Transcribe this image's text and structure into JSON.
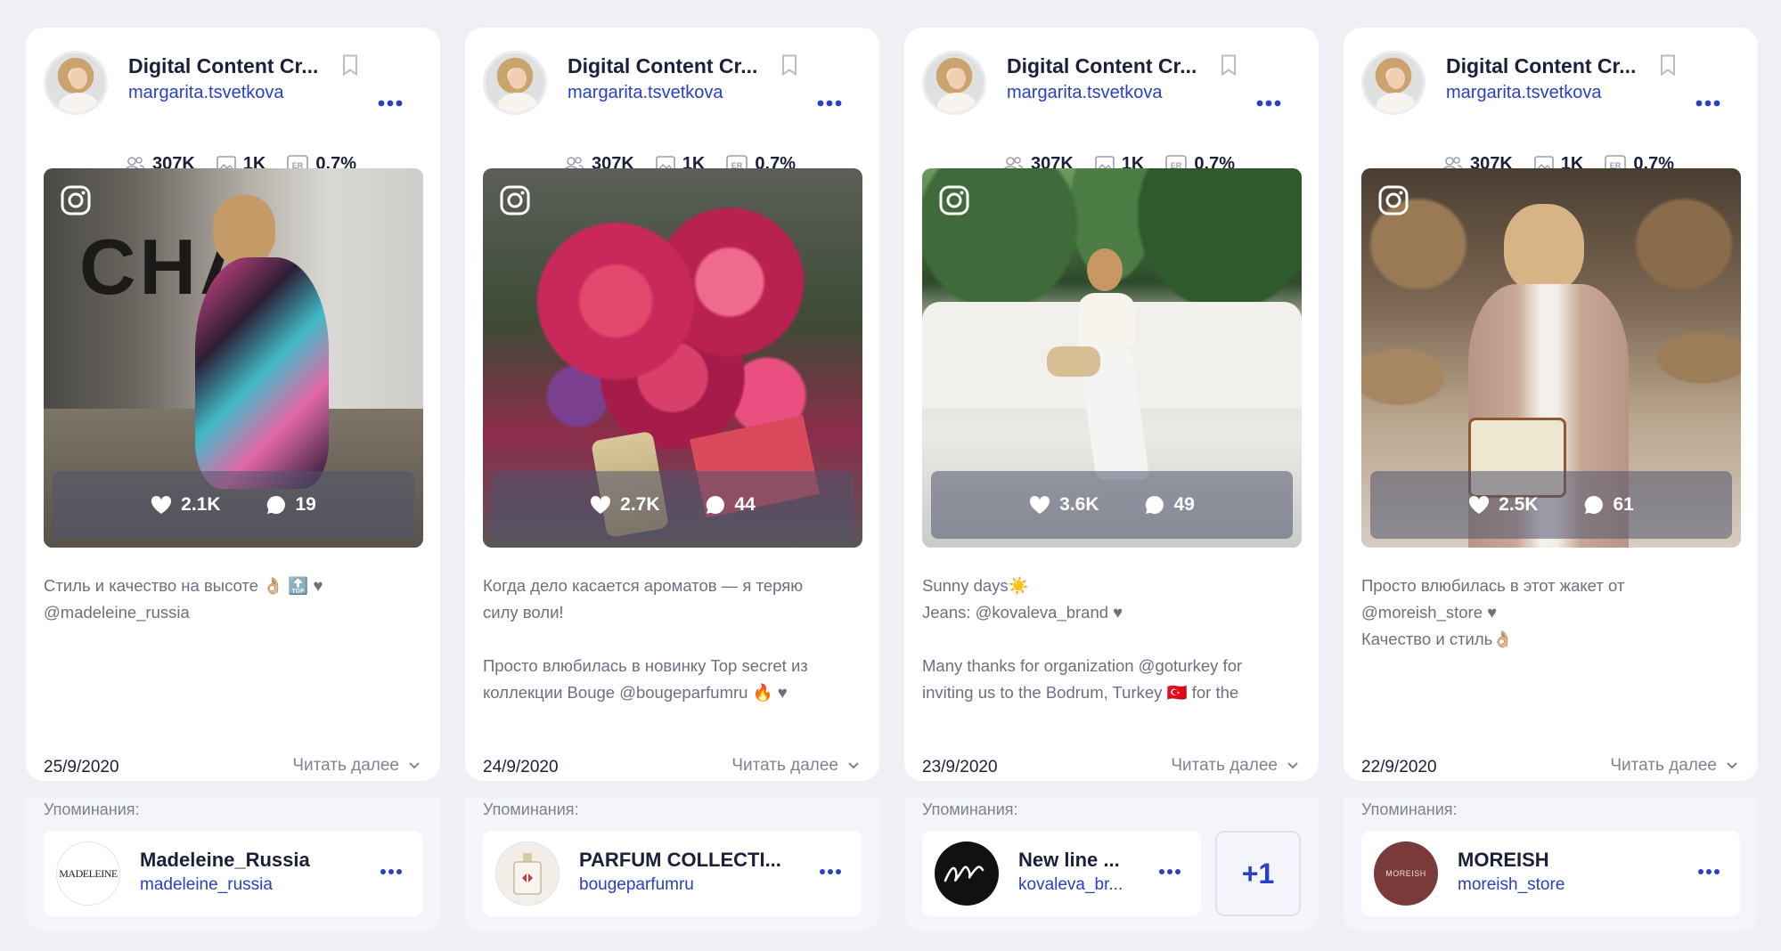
{
  "colors": {
    "accent": "#2a40c0",
    "background": "#eef0f6",
    "card": "#ffffff"
  },
  "icons": {
    "bookmark": "bookmark-icon",
    "more": "more-dots-icon",
    "followers": "followers-icon",
    "posts": "image-icon",
    "er": "er-icon",
    "instagram": "instagram-icon",
    "likes": "heart-icon",
    "comments": "comment-icon",
    "expand": "chevron-down-icon"
  },
  "posts": [
    {
      "profile_name": "Digital Content Cr...",
      "profile_handle": "margarita.tsvetkova",
      "followers": "307K",
      "post_count": "1K",
      "er": "0.7%",
      "likes": "2.1K",
      "comments": "19",
      "caption": "Стиль и качество на высоте 👌🏼 🔝 ♥\n@madeleine_russia",
      "date": "25/9/2020",
      "read_more": "Читать далее",
      "mentions_label": "Упоминания:",
      "mentions": [
        {
          "name": "Madeleine_Russia",
          "handle": "madeleine_russia",
          "logo_text": "MADELEINE"
        }
      ]
    },
    {
      "profile_name": "Digital Content Cr...",
      "profile_handle": "margarita.tsvetkova",
      "followers": "307K",
      "post_count": "1K",
      "er": "0.7%",
      "likes": "2.7K",
      "comments": "44",
      "caption": "Когда дело касается ароматов — я теряю\nсилу воли!\n\nПросто влюбилась в новинку Top secret из\nколлекции Bouge @bougeparfumru 🔥 ♥",
      "date": "24/9/2020",
      "read_more": "Читать далее",
      "mentions_label": "Упоминания:",
      "mentions": [
        {
          "name": "PARFUM COLLECTI...",
          "handle": "bougeparfumru",
          "logo_text": ""
        }
      ]
    },
    {
      "profile_name": "Digital Content Cr...",
      "profile_handle": "margarita.tsvetkova",
      "followers": "307K",
      "post_count": "1K",
      "er": "0.7%",
      "likes": "3.6K",
      "comments": "49",
      "caption": "Sunny days☀️\nJeans: @kovaleva_brand ♥\n\nMany thanks for organization @goturkey for\ninviting us to the Bodrum, Turkey 🇹🇷  for the",
      "date": "23/9/2020",
      "read_more": "Читать далее",
      "mentions_label": "Упоминания:",
      "mentions": [
        {
          "name": "New line ...",
          "handle": "kovaleva_br...",
          "logo_text": ""
        }
      ],
      "extra_mentions": "+1"
    },
    {
      "profile_name": "Digital Content Cr...",
      "profile_handle": "margarita.tsvetkova",
      "followers": "307K",
      "post_count": "1K",
      "er": "0.7%",
      "likes": "2.5K",
      "comments": "61",
      "caption": "Просто влюбилась в этот жакет от\n@moreish_store ♥\nКачество и стиль👌🏼",
      "date": "22/9/2020",
      "read_more": "Читать далее",
      "mentions_label": "Упоминания:",
      "mentions": [
        {
          "name": "MOREISH",
          "handle": "moreish_store",
          "logo_text": "MOREISH"
        }
      ]
    }
  ]
}
